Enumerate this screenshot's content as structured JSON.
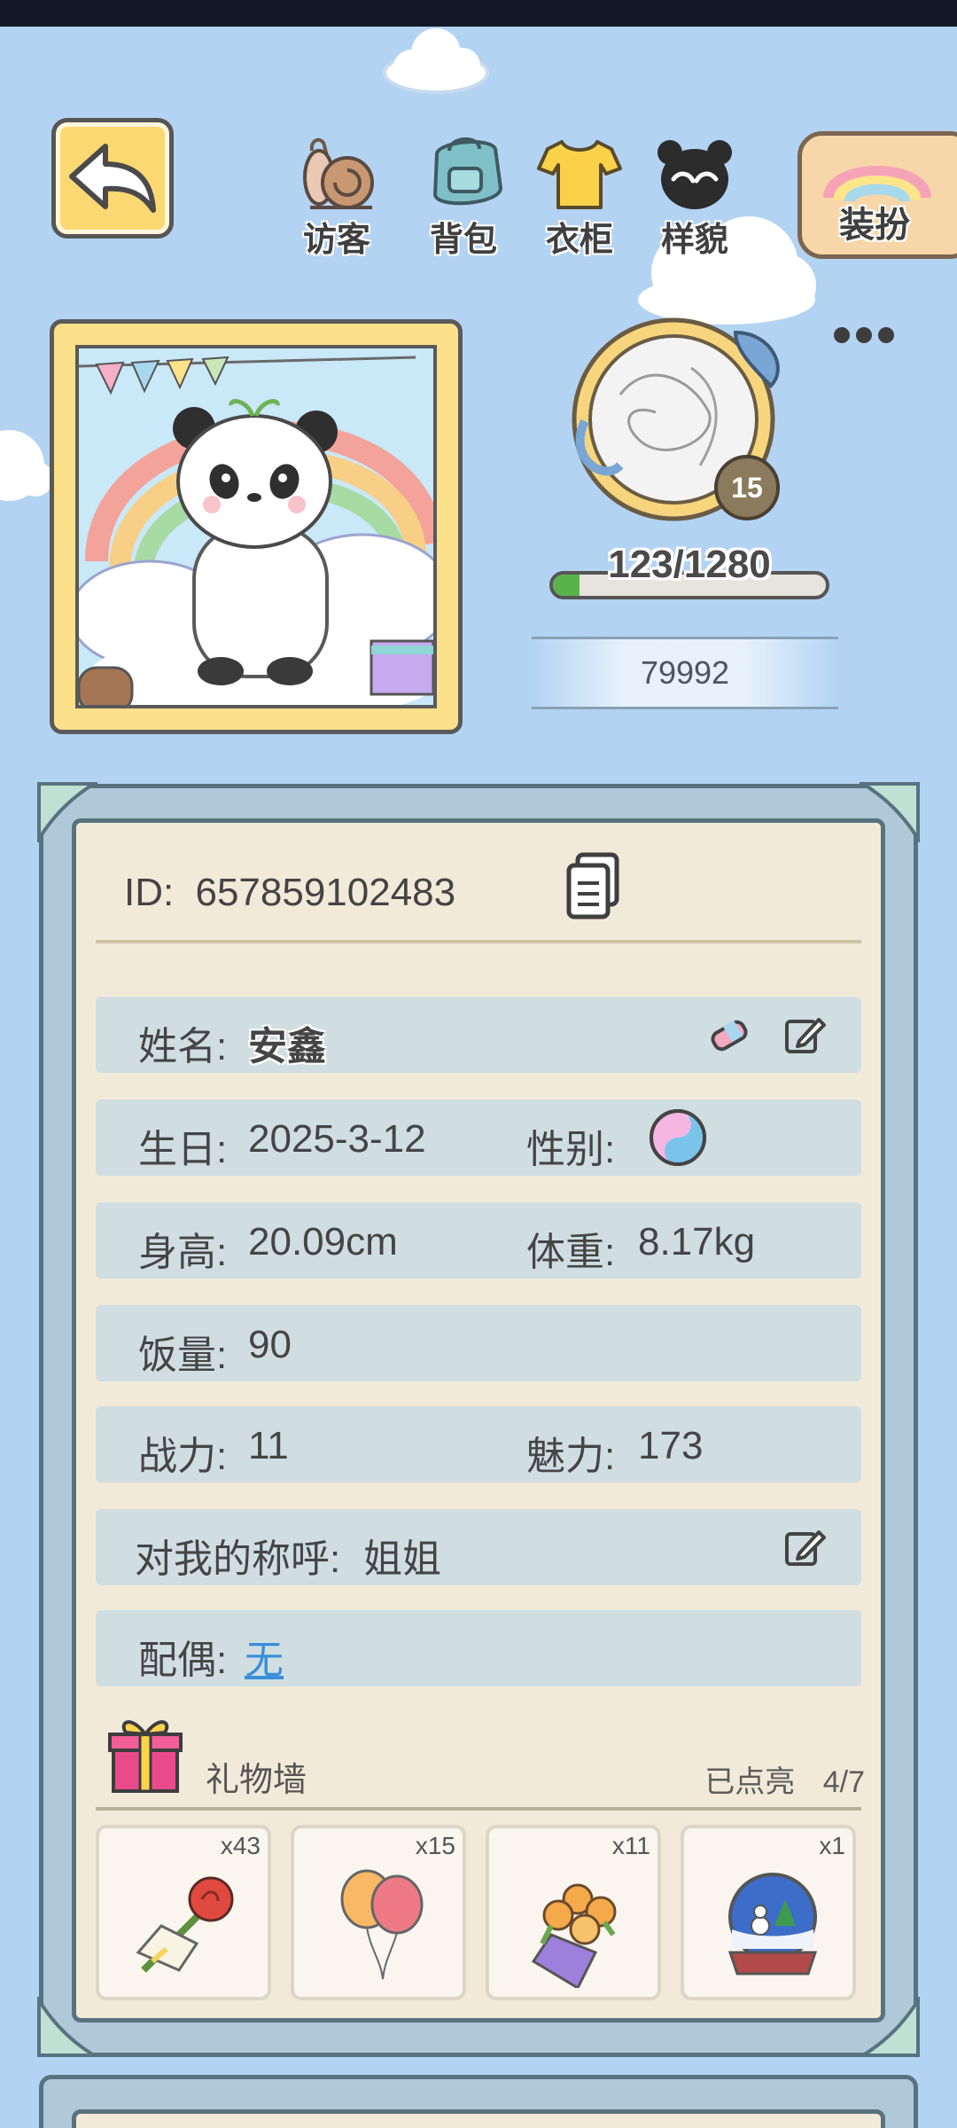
{
  "nav": {
    "visitors": "访客",
    "backpack": "背包",
    "wardrobe": "衣柜",
    "appearance": "样貌",
    "dress_up": "装扮"
  },
  "profile": {
    "level": "15",
    "exp_text": "123/1280",
    "exp_fraction": 0.096,
    "coins": "79992"
  },
  "id_row": {
    "label": "ID:",
    "value": "657859102483"
  },
  "info": {
    "name_label": "姓名:",
    "name_value": "安鑫",
    "birthday_label": "生日:",
    "birthday_value": "2025-3-12",
    "gender_label": "性别:",
    "height_label": "身高:",
    "height_value": "20.09cm",
    "weight_label": "体重:",
    "weight_value": "8.17kg",
    "appetite_label": "饭量:",
    "appetite_value": "90",
    "power_label": "战力:",
    "power_value": "11",
    "charm_label": "魅力:",
    "charm_value": "173",
    "nickname_label": "对我的称呼:",
    "nickname_value": "姐姐",
    "spouse_label": "配偶:",
    "spouse_value": "无"
  },
  "gift_wall": {
    "title": "礼物墙",
    "lit_label": "已点亮",
    "lit_value": "4/7",
    "items": [
      {
        "name": "rose-bouquet",
        "count": "x43"
      },
      {
        "name": "balloons",
        "count": "x15"
      },
      {
        "name": "flower-bouquet",
        "count": "x11"
      },
      {
        "name": "snow-globe",
        "count": "x1"
      }
    ]
  },
  "colors": {
    "background": "#b3d3f3",
    "panel": "#afc9d9",
    "paper": "#f2ead9",
    "row": "#d0dee2",
    "link": "#3a8fd8",
    "exp_fill": "#5ab34a"
  }
}
